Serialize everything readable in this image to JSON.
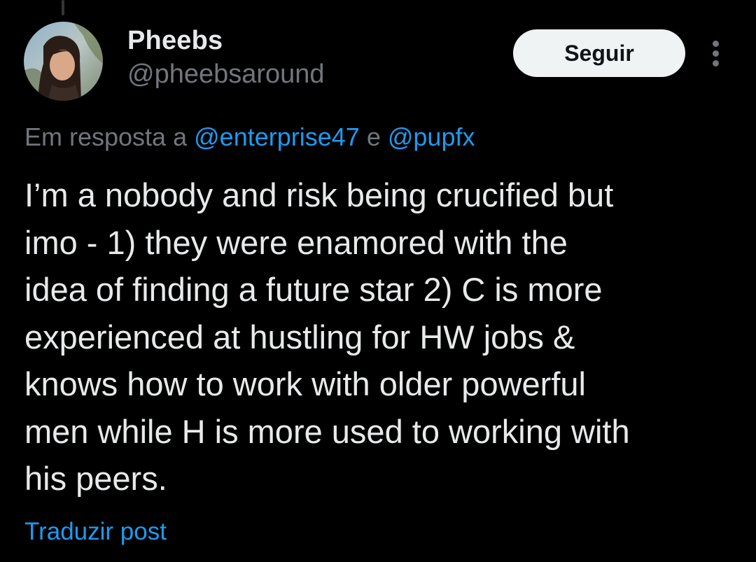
{
  "post": {
    "author": {
      "display_name": "Pheebs",
      "handle": "@pheebsaround",
      "avatar_icon": "user-avatar-photo"
    },
    "follow_label": "Seguir",
    "more_icon": "more-vertical-icon",
    "reply_context": {
      "prefix": "Em resposta a",
      "mention_1": "@enterprise47",
      "conjunction": "e",
      "mention_2": "@pupfx"
    },
    "text_lines": [
      "I’m a nobody and risk being crucified but",
      "imo - 1) they were enamored with the",
      "idea of finding a future star 2) C is more",
      "experienced at hustling for HW jobs &",
      "knows how to work with older powerful",
      "men while H is more used to working with",
      "his peers."
    ],
    "translate_label": "Traduzir post"
  },
  "colors": {
    "background": "#000000",
    "primary_text": "#e7e9ea",
    "secondary_text": "#71767b",
    "link": "#1d9bf0",
    "follow_button_bg": "#eff3f4",
    "follow_button_text": "#0f1419"
  }
}
